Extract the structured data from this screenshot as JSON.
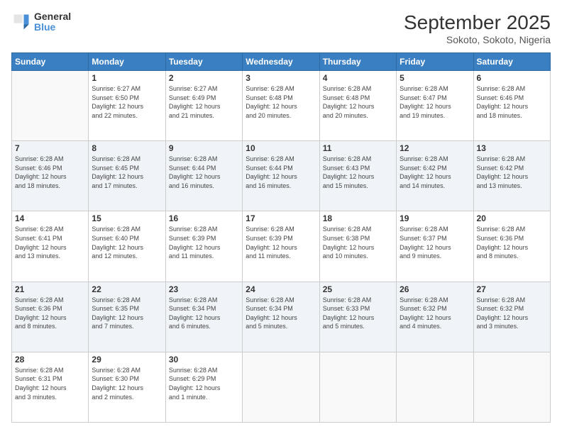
{
  "header": {
    "logo_line1": "General",
    "logo_line2": "Blue",
    "title": "September 2025",
    "subtitle": "Sokoto, Sokoto, Nigeria"
  },
  "weekdays": [
    "Sunday",
    "Monday",
    "Tuesday",
    "Wednesday",
    "Thursday",
    "Friday",
    "Saturday"
  ],
  "weeks": [
    [
      {
        "day": "",
        "info": ""
      },
      {
        "day": "1",
        "info": "Sunrise: 6:27 AM\nSunset: 6:50 PM\nDaylight: 12 hours\nand 22 minutes."
      },
      {
        "day": "2",
        "info": "Sunrise: 6:27 AM\nSunset: 6:49 PM\nDaylight: 12 hours\nand 21 minutes."
      },
      {
        "day": "3",
        "info": "Sunrise: 6:28 AM\nSunset: 6:48 PM\nDaylight: 12 hours\nand 20 minutes."
      },
      {
        "day": "4",
        "info": "Sunrise: 6:28 AM\nSunset: 6:48 PM\nDaylight: 12 hours\nand 20 minutes."
      },
      {
        "day": "5",
        "info": "Sunrise: 6:28 AM\nSunset: 6:47 PM\nDaylight: 12 hours\nand 19 minutes."
      },
      {
        "day": "6",
        "info": "Sunrise: 6:28 AM\nSunset: 6:46 PM\nDaylight: 12 hours\nand 18 minutes."
      }
    ],
    [
      {
        "day": "7",
        "info": "Sunrise: 6:28 AM\nSunset: 6:46 PM\nDaylight: 12 hours\nand 18 minutes."
      },
      {
        "day": "8",
        "info": "Sunrise: 6:28 AM\nSunset: 6:45 PM\nDaylight: 12 hours\nand 17 minutes."
      },
      {
        "day": "9",
        "info": "Sunrise: 6:28 AM\nSunset: 6:44 PM\nDaylight: 12 hours\nand 16 minutes."
      },
      {
        "day": "10",
        "info": "Sunrise: 6:28 AM\nSunset: 6:44 PM\nDaylight: 12 hours\nand 16 minutes."
      },
      {
        "day": "11",
        "info": "Sunrise: 6:28 AM\nSunset: 6:43 PM\nDaylight: 12 hours\nand 15 minutes."
      },
      {
        "day": "12",
        "info": "Sunrise: 6:28 AM\nSunset: 6:42 PM\nDaylight: 12 hours\nand 14 minutes."
      },
      {
        "day": "13",
        "info": "Sunrise: 6:28 AM\nSunset: 6:42 PM\nDaylight: 12 hours\nand 13 minutes."
      }
    ],
    [
      {
        "day": "14",
        "info": "Sunrise: 6:28 AM\nSunset: 6:41 PM\nDaylight: 12 hours\nand 13 minutes."
      },
      {
        "day": "15",
        "info": "Sunrise: 6:28 AM\nSunset: 6:40 PM\nDaylight: 12 hours\nand 12 minutes."
      },
      {
        "day": "16",
        "info": "Sunrise: 6:28 AM\nSunset: 6:39 PM\nDaylight: 12 hours\nand 11 minutes."
      },
      {
        "day": "17",
        "info": "Sunrise: 6:28 AM\nSunset: 6:39 PM\nDaylight: 12 hours\nand 11 minutes."
      },
      {
        "day": "18",
        "info": "Sunrise: 6:28 AM\nSunset: 6:38 PM\nDaylight: 12 hours\nand 10 minutes."
      },
      {
        "day": "19",
        "info": "Sunrise: 6:28 AM\nSunset: 6:37 PM\nDaylight: 12 hours\nand 9 minutes."
      },
      {
        "day": "20",
        "info": "Sunrise: 6:28 AM\nSunset: 6:36 PM\nDaylight: 12 hours\nand 8 minutes."
      }
    ],
    [
      {
        "day": "21",
        "info": "Sunrise: 6:28 AM\nSunset: 6:36 PM\nDaylight: 12 hours\nand 8 minutes."
      },
      {
        "day": "22",
        "info": "Sunrise: 6:28 AM\nSunset: 6:35 PM\nDaylight: 12 hours\nand 7 minutes."
      },
      {
        "day": "23",
        "info": "Sunrise: 6:28 AM\nSunset: 6:34 PM\nDaylight: 12 hours\nand 6 minutes."
      },
      {
        "day": "24",
        "info": "Sunrise: 6:28 AM\nSunset: 6:34 PM\nDaylight: 12 hours\nand 5 minutes."
      },
      {
        "day": "25",
        "info": "Sunrise: 6:28 AM\nSunset: 6:33 PM\nDaylight: 12 hours\nand 5 minutes."
      },
      {
        "day": "26",
        "info": "Sunrise: 6:28 AM\nSunset: 6:32 PM\nDaylight: 12 hours\nand 4 minutes."
      },
      {
        "day": "27",
        "info": "Sunrise: 6:28 AM\nSunset: 6:32 PM\nDaylight: 12 hours\nand 3 minutes."
      }
    ],
    [
      {
        "day": "28",
        "info": "Sunrise: 6:28 AM\nSunset: 6:31 PM\nDaylight: 12 hours\nand 3 minutes."
      },
      {
        "day": "29",
        "info": "Sunrise: 6:28 AM\nSunset: 6:30 PM\nDaylight: 12 hours\nand 2 minutes."
      },
      {
        "day": "30",
        "info": "Sunrise: 6:28 AM\nSunset: 6:29 PM\nDaylight: 12 hours\nand 1 minute."
      },
      {
        "day": "",
        "info": ""
      },
      {
        "day": "",
        "info": ""
      },
      {
        "day": "",
        "info": ""
      },
      {
        "day": "",
        "info": ""
      }
    ]
  ]
}
